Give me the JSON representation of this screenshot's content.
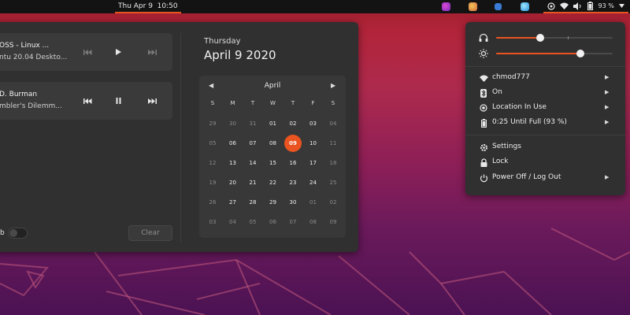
{
  "topbar": {
    "clock": "Thu Apr 9  10:50",
    "tray_icons": [
      "app-icon-1",
      "app-icon-2",
      "app-icon-3",
      "app-icon-4"
    ],
    "battery": "93 %"
  },
  "media": [
    {
      "title": "OSS - Linux ...",
      "subtitle": "ntu 20.04 Deskto...",
      "state": "paused"
    },
    {
      "title": "D. Burman",
      "subtitle": "mbler's Dilemm...",
      "state": "playing"
    }
  ],
  "notifications": {
    "dnd_label": "b",
    "dnd_enabled": false,
    "clear_label": "Clear"
  },
  "calendar": {
    "weekday": "Thursday",
    "date": "April 9 2020",
    "month": "April",
    "weekday_headers": [
      "S",
      "M",
      "T",
      "W",
      "T",
      "F",
      "S"
    ],
    "weeks": [
      [
        "29",
        "30",
        "31",
        "01",
        "02",
        "03",
        "04"
      ],
      [
        "05",
        "06",
        "07",
        "08",
        "09",
        "10",
        "11"
      ],
      [
        "12",
        "13",
        "14",
        "15",
        "16",
        "17",
        "18"
      ],
      [
        "19",
        "20",
        "21",
        "22",
        "23",
        "24",
        "25"
      ],
      [
        "26",
        "27",
        "28",
        "29",
        "30",
        "01",
        "02"
      ],
      [
        "03",
        "04",
        "05",
        "06",
        "07",
        "08",
        "09"
      ]
    ],
    "dim_first_row_count": 3,
    "today": "09"
  },
  "system_menu": {
    "volume_level": 0.38,
    "brightness_level": 0.72,
    "items": [
      {
        "icon": "wifi-icon",
        "label": "chmod777",
        "submenu": true
      },
      {
        "icon": "bluetooth-icon",
        "label": "On",
        "submenu": true
      },
      {
        "icon": "location-icon",
        "label": "Location In Use",
        "submenu": true
      },
      {
        "icon": "battery-icon",
        "label": "0:25 Until Full (93 %)",
        "submenu": true
      },
      {
        "icon": "settings-icon",
        "label": "Settings",
        "submenu": false
      },
      {
        "icon": "lock-icon",
        "label": "Lock",
        "submenu": false
      },
      {
        "icon": "power-icon",
        "label": "Power Off / Log Out",
        "submenu": true
      }
    ]
  },
  "colors": {
    "accent": "#e95420",
    "panel": "#303030",
    "topbar": "#131313"
  }
}
